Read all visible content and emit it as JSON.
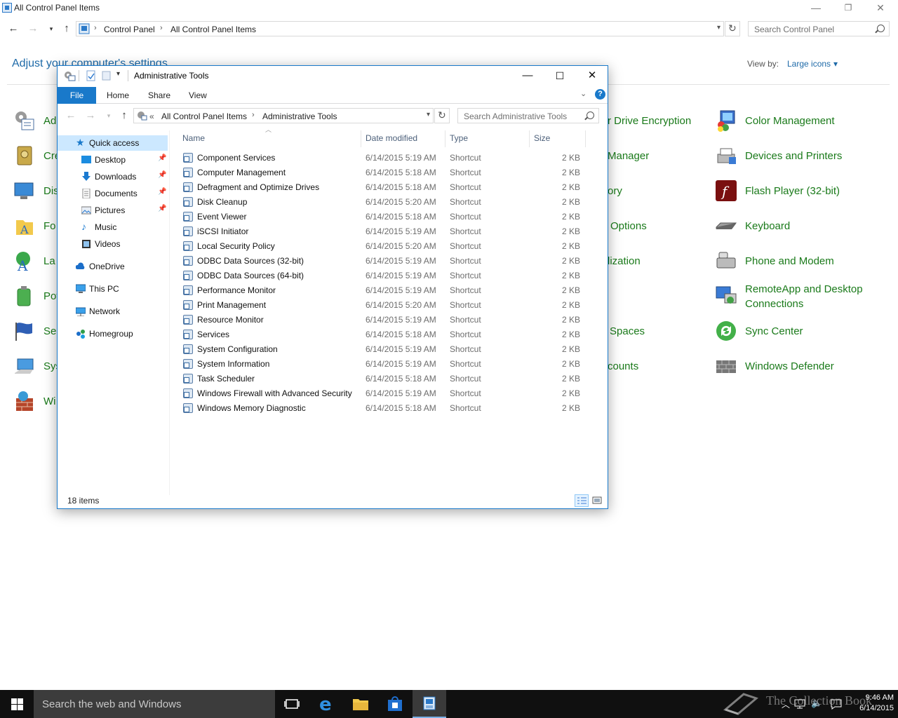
{
  "control_panel": {
    "title": "All Control Panel Items",
    "breadcrumb": [
      "Control Panel",
      "All Control Panel Items"
    ],
    "search_placeholder": "Search Control Panel",
    "heading": "Adjust your computer's settings",
    "view_by_label": "View by:",
    "view_by_value": "Large icons",
    "left_column": [
      "Ad",
      "Cre",
      "Dis",
      "Fo",
      "La",
      "Pov",
      "Sec",
      "Sys",
      "Wi"
    ],
    "middle_column": [
      "r Drive Encryption",
      "Manager",
      "ory",
      "Options",
      "lization",
      "Spaces",
      "counts"
    ],
    "right_column": [
      {
        "label": "Color Management",
        "icon": "color-management-icon"
      },
      {
        "label": "Devices and Printers",
        "icon": "devices-printers-icon"
      },
      {
        "label": "Flash Player (32-bit)",
        "icon": "flash-player-icon"
      },
      {
        "label": "Keyboard",
        "icon": "keyboard-icon"
      },
      {
        "label": "Phone and Modem",
        "icon": "phone-modem-icon"
      },
      {
        "label": "RemoteApp and Desktop",
        "label2": "Connections",
        "icon": "remoteapp-icon"
      },
      {
        "label": "Sync Center",
        "icon": "sync-center-icon"
      },
      {
        "label": "Windows Defender",
        "icon": "windows-defender-icon"
      }
    ]
  },
  "explorer": {
    "title": "Administrative Tools",
    "ribbon": {
      "file": "File",
      "home": "Home",
      "share": "Share",
      "view": "View"
    },
    "address": {
      "prefix": "«",
      "crumbs": [
        "All Control Panel Items",
        "Administrative Tools"
      ]
    },
    "search_placeholder": "Search Administrative Tools",
    "nav": {
      "quick_access": "Quick access",
      "desktop": "Desktop",
      "downloads": "Downloads",
      "documents": "Documents",
      "pictures": "Pictures",
      "music": "Music",
      "videos": "Videos",
      "onedrive": "OneDrive",
      "this_pc": "This PC",
      "network": "Network",
      "homegroup": "Homegroup"
    },
    "columns": {
      "name": "Name",
      "date": "Date modified",
      "type": "Type",
      "size": "Size"
    },
    "files": [
      {
        "name": "Component Services",
        "date": "6/14/2015 5:19 AM",
        "type": "Shortcut",
        "size": "2 KB"
      },
      {
        "name": "Computer Management",
        "date": "6/14/2015 5:18 AM",
        "type": "Shortcut",
        "size": "2 KB"
      },
      {
        "name": "Defragment and Optimize Drives",
        "date": "6/14/2015 5:18 AM",
        "type": "Shortcut",
        "size": "2 KB"
      },
      {
        "name": "Disk Cleanup",
        "date": "6/14/2015 5:20 AM",
        "type": "Shortcut",
        "size": "2 KB"
      },
      {
        "name": "Event Viewer",
        "date": "6/14/2015 5:18 AM",
        "type": "Shortcut",
        "size": "2 KB"
      },
      {
        "name": "iSCSI Initiator",
        "date": "6/14/2015 5:19 AM",
        "type": "Shortcut",
        "size": "2 KB"
      },
      {
        "name": "Local Security Policy",
        "date": "6/14/2015 5:20 AM",
        "type": "Shortcut",
        "size": "2 KB"
      },
      {
        "name": "ODBC Data Sources (32-bit)",
        "date": "6/14/2015 5:19 AM",
        "type": "Shortcut",
        "size": "2 KB"
      },
      {
        "name": "ODBC Data Sources (64-bit)",
        "date": "6/14/2015 5:19 AM",
        "type": "Shortcut",
        "size": "2 KB"
      },
      {
        "name": "Performance Monitor",
        "date": "6/14/2015 5:19 AM",
        "type": "Shortcut",
        "size": "2 KB"
      },
      {
        "name": "Print Management",
        "date": "6/14/2015 5:20 AM",
        "type": "Shortcut",
        "size": "2 KB"
      },
      {
        "name": "Resource Monitor",
        "date": "6/14/2015 5:19 AM",
        "type": "Shortcut",
        "size": "2 KB"
      },
      {
        "name": "Services",
        "date": "6/14/2015 5:18 AM",
        "type": "Shortcut",
        "size": "2 KB"
      },
      {
        "name": "System Configuration",
        "date": "6/14/2015 5:19 AM",
        "type": "Shortcut",
        "size": "2 KB"
      },
      {
        "name": "System Information",
        "date": "6/14/2015 5:19 AM",
        "type": "Shortcut",
        "size": "2 KB"
      },
      {
        "name": "Task Scheduler",
        "date": "6/14/2015 5:18 AM",
        "type": "Shortcut",
        "size": "2 KB"
      },
      {
        "name": "Windows Firewall with Advanced Security",
        "date": "6/14/2015 5:19 AM",
        "type": "Shortcut",
        "size": "2 KB"
      },
      {
        "name": "Windows Memory Diagnostic",
        "date": "6/14/2015 5:18 AM",
        "type": "Shortcut",
        "size": "2 KB"
      }
    ],
    "status": "18 items"
  },
  "taskbar": {
    "search_placeholder": "Search the web and Windows",
    "time": "9:46 AM",
    "date": "6/14/2015",
    "watermark": "The Collection Book"
  },
  "colors": {
    "accent": "#1979ca",
    "link_green": "#1a7a1a",
    "heading_blue": "#1e6aa8",
    "taskbar": "#101010"
  }
}
